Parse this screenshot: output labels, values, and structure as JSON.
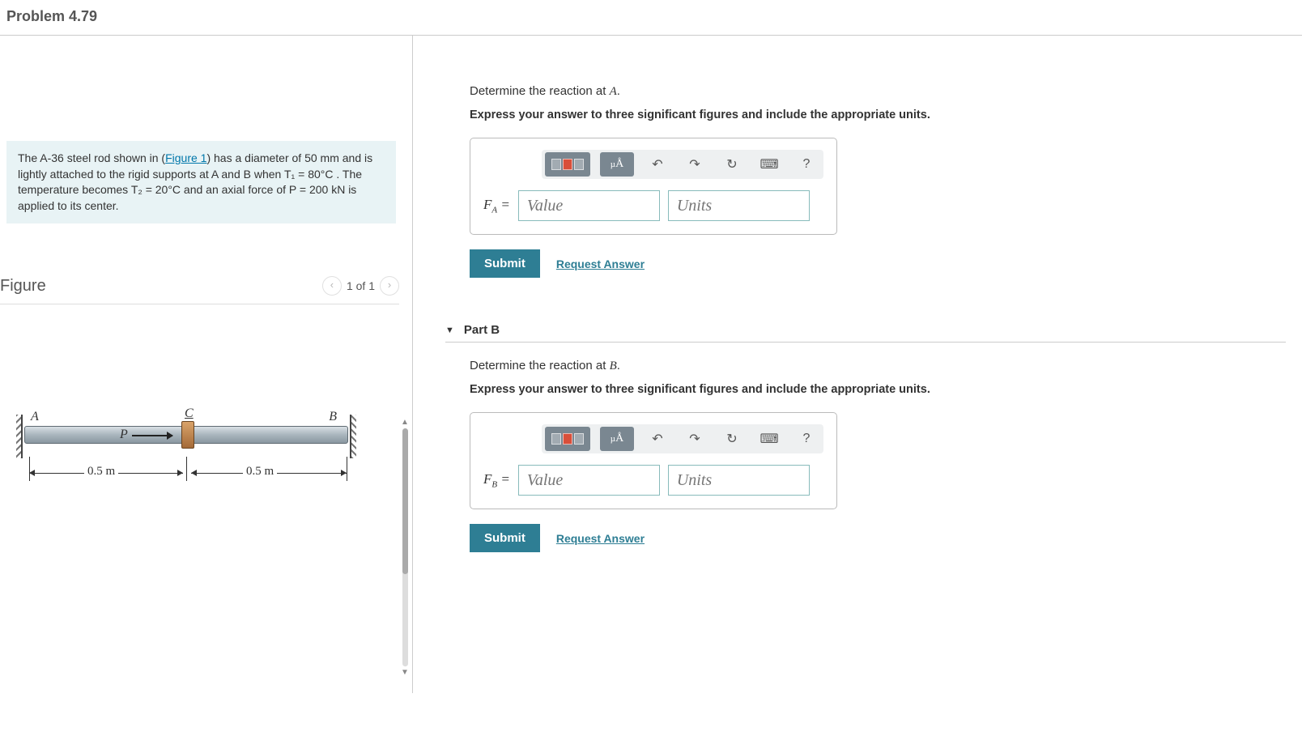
{
  "header": {
    "title": "Problem 4.79"
  },
  "left": {
    "problem_html_pre": "The A-36 steel rod shown in (",
    "figure_link": "Figure 1",
    "problem_html_post": ") has a diameter of 50 mm and is lightly attached to the rigid supports at A and B when T₁ = 80°C . The temperature becomes T₂ = 20°C and an axial force of P = 200 kN is applied to its center.",
    "figure_title": "Figure",
    "nav_text": "1 of 1",
    "diagram": {
      "A": "A",
      "B": "B",
      "C": "C",
      "P": "P",
      "dim1": "0.5 m",
      "dim2": "0.5 m"
    }
  },
  "right": {
    "partA": {
      "prompt_pre": "Determine the reaction at ",
      "prompt_var": "A",
      "prompt_post": ".",
      "instructions": "Express your answer to three significant figures and include the appropriate units.",
      "label_var": "F",
      "label_sub": "A",
      "label_eq": " = ",
      "value_ph": "Value",
      "units_ph": "Units",
      "submit": "Submit",
      "request": "Request Answer",
      "help": "?"
    },
    "partB": {
      "heading": "Part B",
      "prompt_pre": "Determine the reaction at ",
      "prompt_var": "B",
      "prompt_post": ".",
      "instructions": "Express your answer to three significant figures and include the appropriate units.",
      "label_var": "F",
      "label_sub": "B",
      "label_eq": " = ",
      "value_ph": "Value",
      "units_ph": "Units",
      "submit": "Submit",
      "request": "Request Answer",
      "help": "?"
    }
  }
}
